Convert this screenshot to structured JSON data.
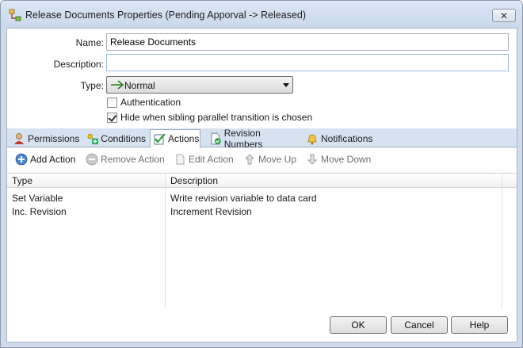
{
  "window": {
    "title": "Release Documents Properties (Pending Apporval -> Released)",
    "close_label": "✕"
  },
  "form": {
    "name_label": "Name:",
    "name_value": "Release Documents",
    "description_label": "Description:",
    "description_value": "",
    "type_label": "Type:",
    "type_value": "Normal",
    "authentication_label": "Authentication",
    "authentication_checked": false,
    "hide_label": "Hide when sibling parallel transition is chosen",
    "hide_checked": true
  },
  "tabs": [
    {
      "label": "Permissions",
      "icon": "user-icon"
    },
    {
      "label": "Conditions",
      "icon": "conditions-icon"
    },
    {
      "label": "Actions",
      "icon": "actions-checklist-icon",
      "active": true
    },
    {
      "label": "Revision Numbers",
      "icon": "revision-icon"
    },
    {
      "label": "Notifications",
      "icon": "bell-icon"
    }
  ],
  "toolbar": {
    "add": "Add Action",
    "remove": "Remove Action",
    "edit": "Edit Action",
    "up": "Move Up",
    "down": "Move Down"
  },
  "grid": {
    "columns": [
      "Type",
      "Description"
    ],
    "rows": [
      {
        "type": "Set Variable",
        "description": "Write revision variable to data card"
      },
      {
        "type": "Inc. Revision",
        "description": "Increment Revision"
      }
    ]
  },
  "buttons": {
    "ok": "OK",
    "cancel": "Cancel",
    "help": "Help"
  }
}
